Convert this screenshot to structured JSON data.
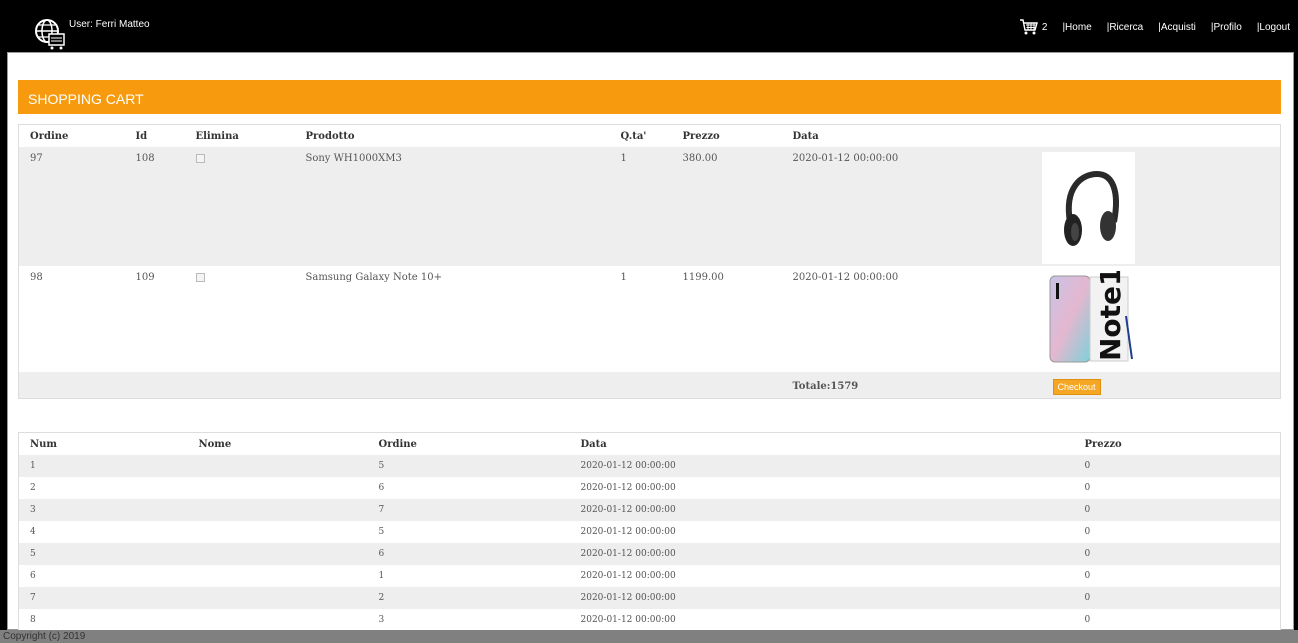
{
  "header": {
    "user_label": "User: Ferri Matteo",
    "cart_count": "2",
    "nav": [
      "|Home",
      "|Ricerca",
      "|Acquisti",
      "|Profilo",
      "|Logout"
    ]
  },
  "cart": {
    "title": "SHOPPING CART",
    "columns": [
      "Ordine",
      "Id",
      "Elimina",
      "Prodotto",
      "Q.ta'",
      "Prezzo",
      "Data"
    ],
    "rows": [
      {
        "ordine": "97",
        "id": "108",
        "prodotto": "Sony WH1000XM3",
        "qta": "1",
        "prezzo": "380.00",
        "data": "2020-01-12 00:00:00",
        "image": "headphones"
      },
      {
        "ordine": "98",
        "id": "109",
        "prodotto": "Samsung Galaxy Note 10+",
        "qta": "1",
        "prezzo": "1199.00",
        "data": "2020-01-12 00:00:00",
        "image": "phone"
      }
    ],
    "total": "Totale:1579",
    "checkout_label": "Checkout"
  },
  "orders": {
    "columns": [
      "Num",
      "Nome",
      "Ordine",
      "Data",
      "Prezzo"
    ],
    "rows": [
      {
        "num": "1",
        "nome": "",
        "ordine": "5",
        "data": "2020-01-12 00:00:00",
        "prezzo": "0"
      },
      {
        "num": "2",
        "nome": "",
        "ordine": "6",
        "data": "2020-01-12 00:00:00",
        "prezzo": "0"
      },
      {
        "num": "3",
        "nome": "",
        "ordine": "7",
        "data": "2020-01-12 00:00:00",
        "prezzo": "0"
      },
      {
        "num": "4",
        "nome": "",
        "ordine": "5",
        "data": "2020-01-12 00:00:00",
        "prezzo": "0"
      },
      {
        "num": "5",
        "nome": "",
        "ordine": "6",
        "data": "2020-01-12 00:00:00",
        "prezzo": "0"
      },
      {
        "num": "6",
        "nome": "",
        "ordine": "1",
        "data": "2020-01-12 00:00:00",
        "prezzo": "0"
      },
      {
        "num": "7",
        "nome": "",
        "ordine": "2",
        "data": "2020-01-12 00:00:00",
        "prezzo": "0"
      },
      {
        "num": "8",
        "nome": "",
        "ordine": "3",
        "data": "2020-01-12 00:00:00",
        "prezzo": "0"
      }
    ]
  },
  "footer": {
    "text": "Copyright (c) 2019"
  },
  "colors": {
    "accent": "#f79a0e",
    "header_bg": "#000000",
    "row_alt": "#eeeeee"
  },
  "icons": {
    "logo": "globe-cart-icon",
    "cart": "cart-icon"
  }
}
